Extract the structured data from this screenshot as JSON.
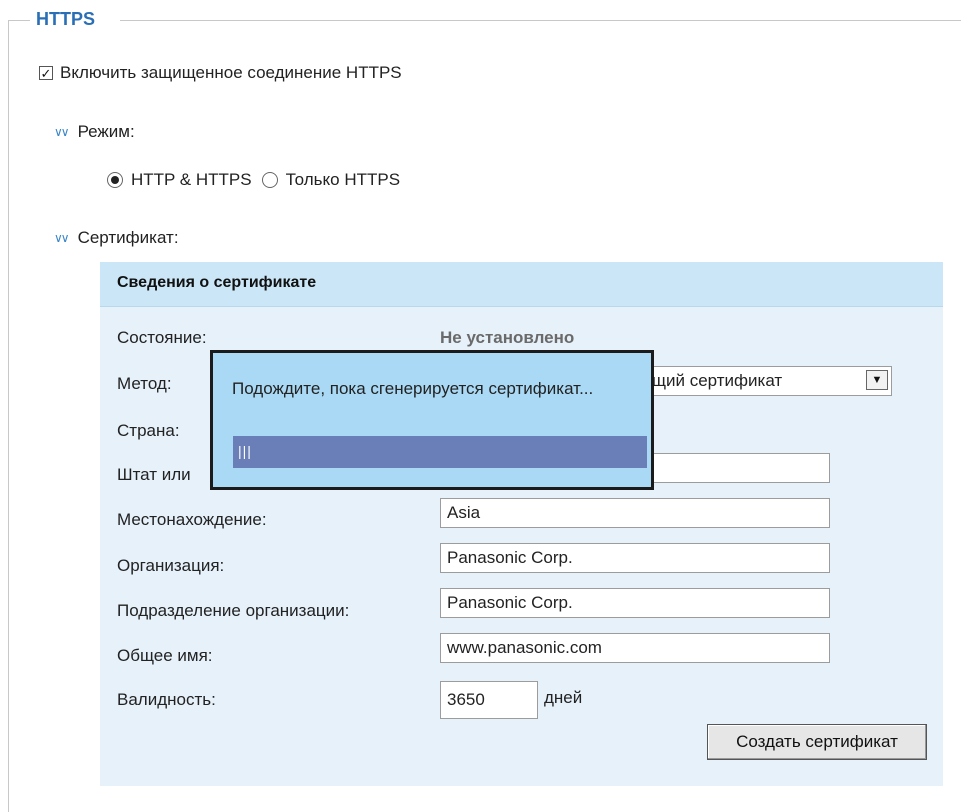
{
  "section": {
    "legend": "HTTPS",
    "enable_label": "Включить защищенное соединение HTTPS",
    "enable_checked": true,
    "mode_label": "Режим:",
    "mode_options": [
      {
        "label": "HTTP & HTTPS",
        "selected": true
      },
      {
        "label": "Только HTTPS",
        "selected": false
      }
    ],
    "certificate_label": "Сертификат:"
  },
  "panel": {
    "title": "Сведения о сертификате",
    "fields": {
      "status_label": "Состояние:",
      "status_value": "Не установлено",
      "method_label": "Метод:",
      "method_visible_value": "щий сертификат",
      "country_label": "Страна:",
      "state_label": "Штат или",
      "location_label": "Местонахождение:",
      "location_value": "Asia",
      "organization_label": "Организация:",
      "organization_value": "Panasonic Corp.",
      "org_unit_label": "Подразделение организации:",
      "org_unit_value": "Panasonic Corp.",
      "common_name_label": "Общее имя:",
      "common_name_value": "www.panasonic.com",
      "validity_label": "Валидность:",
      "validity_value": "3650",
      "validity_unit": "дней"
    },
    "create_button": "Создать сертификат"
  },
  "dialog": {
    "message": "Подождите, пока сгенерируется сертификат...",
    "progress_text": "|||"
  },
  "colors": {
    "legend": "#2a6fb5",
    "panel_bg": "#e6f1fa",
    "panel_header": "#cbe6f7",
    "dialog_bg": "#a9d9f4",
    "progress": "#6a7fb8"
  }
}
